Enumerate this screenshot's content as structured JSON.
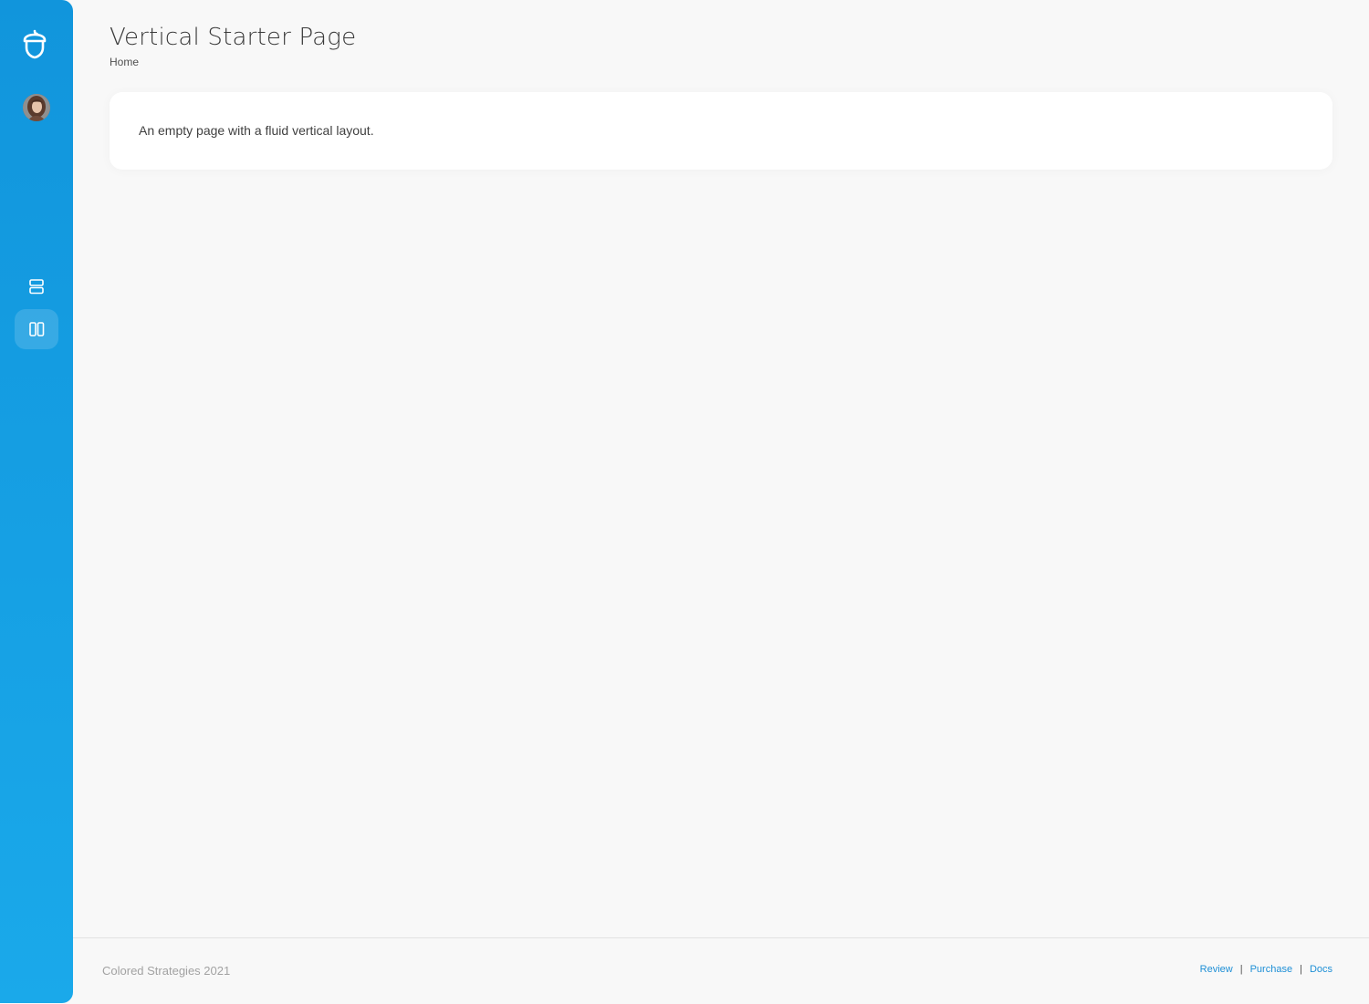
{
  "sidebar": {
    "logo_icon": "acorn-logo-icon",
    "avatar": "user-avatar",
    "nav": [
      {
        "icon": "rows-layout-icon",
        "active": false
      },
      {
        "icon": "columns-layout-icon",
        "active": true
      }
    ]
  },
  "header": {
    "title": "Vertical Starter Page",
    "breadcrumb": "Home"
  },
  "card": {
    "text": "An empty page with a fluid vertical layout."
  },
  "footer": {
    "copyright": "Colored Strategies 2021",
    "links": [
      {
        "label": "Review"
      },
      {
        "label": "Purchase"
      },
      {
        "label": "Docs"
      }
    ],
    "separator": "|"
  },
  "colors": {
    "sidebar_top": "#1195dc",
    "sidebar_bottom": "#1aa9ea",
    "link": "#1e8fd6",
    "background": "#f8f8f8"
  }
}
